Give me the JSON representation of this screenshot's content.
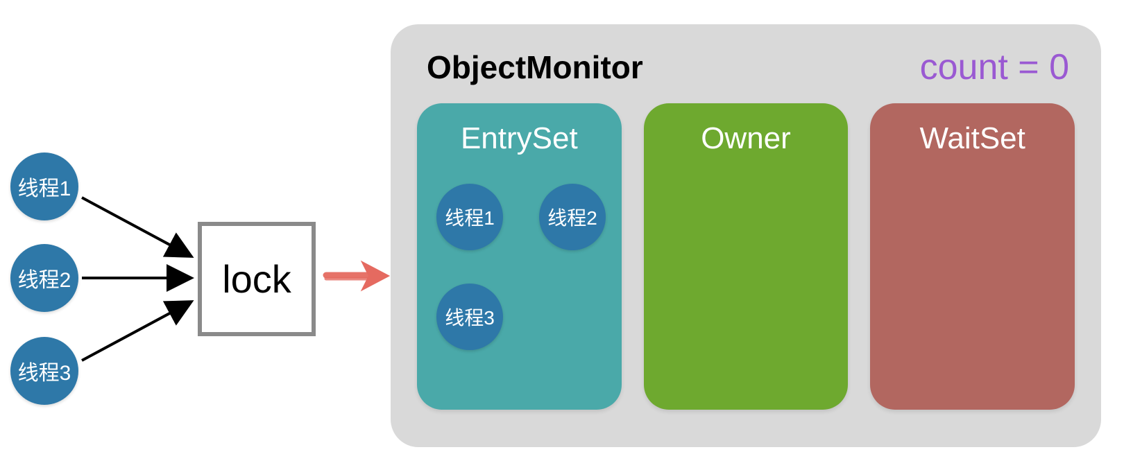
{
  "threads": {
    "t1": "线程1",
    "t2": "线程2",
    "t3": "线程3"
  },
  "lock": {
    "label": "lock"
  },
  "monitor": {
    "title": "ObjectMonitor",
    "count_label": "count = 0",
    "entryset": {
      "label": "EntrySet",
      "threads": {
        "t1": "线程1",
        "t2": "线程2",
        "t3": "线程3"
      }
    },
    "owner": {
      "label": "Owner"
    },
    "waitset": {
      "label": "WaitSet"
    }
  },
  "colors": {
    "thread": "#2e78a8",
    "monitor_bg": "#d9d9d9",
    "entryset": "#4aa9a9",
    "owner": "#6ea92f",
    "waitset": "#b26760",
    "count": "#9a59d2",
    "arrow_red": "#e56a60"
  }
}
